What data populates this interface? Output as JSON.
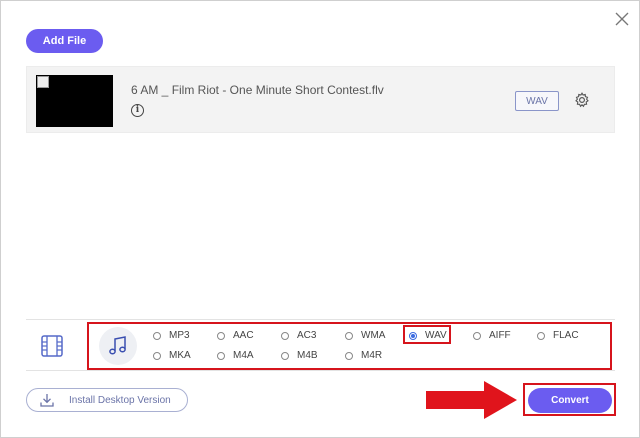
{
  "toolbar": {
    "add_file_label": "Add File"
  },
  "file": {
    "name": "6 AM _ Film Riot - One Minute Short Contest.flv",
    "output_format": "WAV"
  },
  "format_panel": {
    "selected": "WAV",
    "row1": [
      "MP3",
      "AAC",
      "AC3",
      "WMA",
      "WAV",
      "AIFF",
      "FLAC"
    ],
    "row2": [
      "MKA",
      "M4A",
      "M4B",
      "M4R"
    ]
  },
  "footer": {
    "install_label": "Install Desktop Version",
    "convert_label": "Convert"
  },
  "colors": {
    "accent": "#6b5cf0",
    "highlight": "#d6141c"
  },
  "icons": [
    "close-icon",
    "info-icon",
    "gear-icon",
    "video-format-icon",
    "music-note-icon",
    "download-icon",
    "arrow-pointer-icon"
  ]
}
